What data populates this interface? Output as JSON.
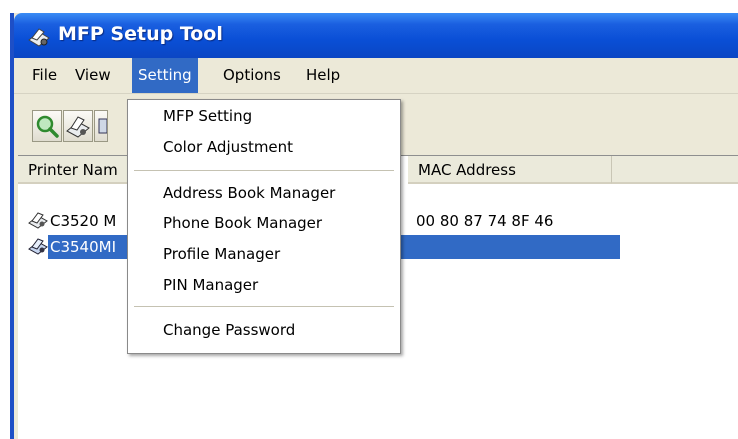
{
  "window": {
    "title": "MFP Setup Tool",
    "title_icon": "printer-gear-icon"
  },
  "menubar": {
    "items": [
      {
        "label": "File"
      },
      {
        "label": "View"
      },
      {
        "label": "Setting",
        "active": true
      },
      {
        "label": "Options"
      },
      {
        "label": "Help"
      }
    ]
  },
  "toolbar": {
    "buttons": [
      {
        "icon": "search-icon"
      },
      {
        "icon": "printer-setup-icon"
      },
      {
        "icon": "printer-properties-icon"
      }
    ]
  },
  "setting_menu": {
    "items": [
      {
        "label": "MFP Setting"
      },
      {
        "label": "Color Adjustment"
      },
      {
        "label": "Address Book Manager"
      },
      {
        "label": "Phone Book Manager"
      },
      {
        "label": "Profile Manager"
      },
      {
        "label": "PIN Manager"
      },
      {
        "label": "Change Password"
      }
    ]
  },
  "list": {
    "columns": [
      {
        "label": "Printer Nam"
      },
      {
        "label": "MAC Address"
      }
    ],
    "rows": [
      {
        "name": "C3520 M",
        "mac": "00 80 87 74 8F 46",
        "selected": false,
        "icon": "printer-icon"
      },
      {
        "name": "C3540MI",
        "mac": "",
        "selected": true,
        "icon": "printer-icon"
      }
    ]
  },
  "colors": {
    "titlebar": "#0a4fd6",
    "selection": "#316ac5",
    "chrome": "#ece9d8"
  }
}
